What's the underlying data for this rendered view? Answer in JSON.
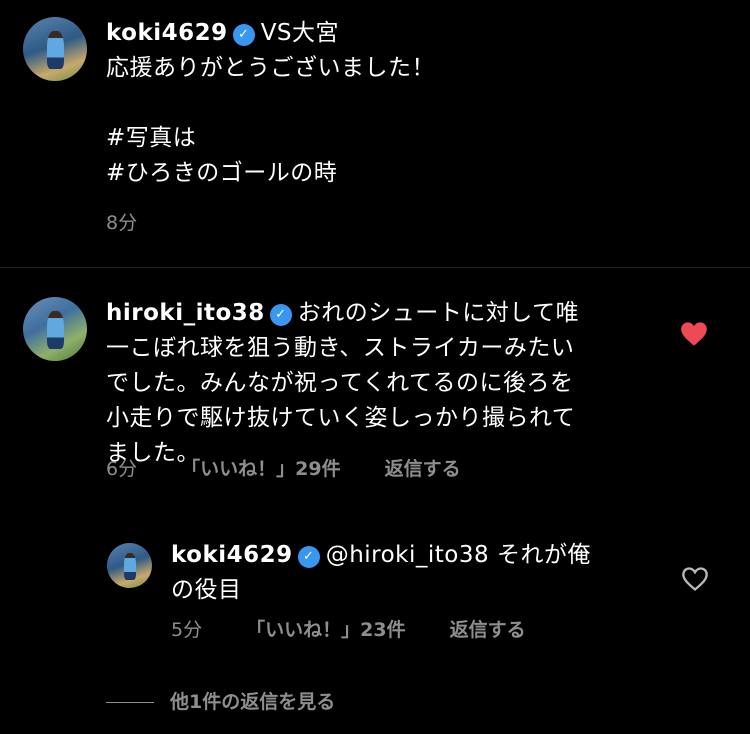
{
  "caption": {
    "username": "koki4629",
    "verified_icon": "check",
    "lines": [
      "VS大宮",
      "応援ありがとうございました！",
      "",
      "#写真は",
      "#ひろきのゴールの時"
    ],
    "time": "8分"
  },
  "comment": {
    "username": "hiroki_ito38",
    "verified_icon": "check",
    "text_lines": [
      "おれのシュートに対して唯",
      "一こぼれ球を狙う動き、ストライカーみたい",
      "でした。みんなが祝ってくれてるのに後ろを",
      "小走りで駆け抜けていく姿しっかり撮られて",
      "ました。"
    ],
    "time": "6分",
    "likes": "「いいね！」29件",
    "reply_label": "返信する",
    "liked": true,
    "heart_color": "#ed4956"
  },
  "reply": {
    "username": "koki4629",
    "verified_icon": "check",
    "text_lines": [
      "@hiroki_ito38 それが俺",
      "の役目"
    ],
    "time": "5分",
    "likes": "「いいね！」23件",
    "reply_label": "返信する",
    "liked": false
  },
  "view_more": "他1件の返信を見る"
}
